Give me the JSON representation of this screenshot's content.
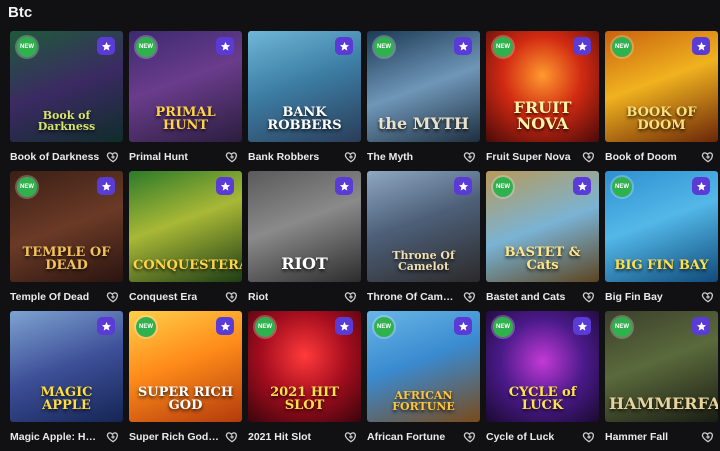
{
  "page": {
    "title": "Btc"
  },
  "colors": {
    "new_badge": "#2fb24e",
    "favorite_badge": "#5a3bd6",
    "background": "#111114"
  },
  "badges": {
    "new_label": "NEW"
  },
  "games": [
    {
      "name": "Book of Darkness",
      "art_title": "Book of Darkness",
      "new": true,
      "bg": "linear-gradient(160deg,#1f5a3a 0%,#3b2a63 50%,#0f2d2a 100%)",
      "title_color": "#d6e46a"
    },
    {
      "name": "Primal Hunt",
      "art_title": "PRIMAL HUNT",
      "new": true,
      "bg": "linear-gradient(160deg,#3c2a6e 0%,#6a3c8c 45%,#2a1e3d 100%)",
      "title_color": "#ffd24a"
    },
    {
      "name": "Bank Robbers",
      "art_title": "BANK ROBBERS",
      "new": false,
      "bg": "linear-gradient(160deg,#6fb7d8 0%,#3d7ea5 45%,#2a3d59 100%)",
      "title_color": "#ffffff"
    },
    {
      "name": "The Myth",
      "art_title": "the MYTH",
      "new": true,
      "bg": "linear-gradient(160deg,#1b3a55 0%,#6f96b8 50%,#1e2f3f 100%)",
      "title_color": "#e8e2cc"
    },
    {
      "name": "Fruit Super Nova",
      "art_title": "FRUIT NOVA",
      "new": true,
      "bg": "radial-gradient(circle at 50% 40%,#ff9a2e 0%,#d12a12 45%,#4a0a0a 100%)",
      "title_color": "#fff4a8"
    },
    {
      "name": "Book of Doom",
      "art_title": "BOOK OF DOOM",
      "new": true,
      "bg": "linear-gradient(160deg,#c9620f 0%,#f0b21f 45%,#6a2508 100%)",
      "title_color": "#ffe07a"
    },
    {
      "name": "Temple Of Dead",
      "art_title": "TEMPLE OF DEAD",
      "new": true,
      "bg": "linear-gradient(160deg,#3a1f16 0%,#6b3a26 50%,#2a1410 100%)",
      "title_color": "#f3c25a"
    },
    {
      "name": "Conquest Era",
      "art_title": "CONQUESTERA",
      "new": false,
      "bg": "linear-gradient(160deg,#2c7a2a 0%,#a9b836 45%,#1d3d16 100%)",
      "title_color": "#ffd34a"
    },
    {
      "name": "Riot",
      "art_title": "RIOT",
      "new": false,
      "bg": "linear-gradient(160deg,#5a5a5a 0%,#8a8a8a 45%,#2c2c2c 100%)",
      "title_color": "#ffffff"
    },
    {
      "name": "Throne Of Camelot",
      "art_title": "Throne Of Camelot",
      "new": false,
      "bg": "linear-gradient(160deg,#8fa8c3 0%,#4d5f78 45%,#2c2a2a 100%)",
      "title_color": "#f0e0b0"
    },
    {
      "name": "Bastet and Cats",
      "art_title": "BASTET & Cats",
      "new": true,
      "bg": "linear-gradient(160deg,#b79a5a 0%,#7ab3d4 50%,#5c4420 100%)",
      "title_color": "#ffe58a"
    },
    {
      "name": "Big Fin Bay",
      "art_title": "BIG FIN BAY",
      "new": true,
      "bg": "linear-gradient(160deg,#2f8fd0 0%,#53b8e8 45%,#0f4a7a 100%)",
      "title_color": "#ffe04a"
    },
    {
      "name": "Magic Apple: Hold ...",
      "art_title": "MAGIC APPLE",
      "new": false,
      "bg": "linear-gradient(160deg,#7ea3d1 0%,#3d4f98 50%,#152555 100%)",
      "title_color": "#ffdd3a"
    },
    {
      "name": "Super Rich God Ho...",
      "art_title": "SUPER RICH GOD",
      "new": true,
      "bg": "linear-gradient(160deg,#ffcf4a 0%,#ff8c1a 45%,#b23a0c 100%)",
      "title_color": "#ffffff"
    },
    {
      "name": "2021 Hit Slot",
      "art_title": "2021 HIT SLOT",
      "new": true,
      "bg": "radial-gradient(circle at 50% 40%,#ff3a3a 0%,#a30d1e 50%,#3a050c 100%)",
      "title_color": "#ffe04a"
    },
    {
      "name": "African Fortune",
      "art_title": "AFRICAN FORTUNE",
      "new": true,
      "bg": "linear-gradient(160deg,#68b7e6 0%,#3a8ad0 45%,#7a4a1a 100%)",
      "title_color": "#ffc43a"
    },
    {
      "name": "Cycle of Luck",
      "art_title": "CYCLE of LUCK",
      "new": true,
      "bg": "radial-gradient(circle at 50% 45%,#c23ad6 0%,#4a1a8a 50%,#1a0a30 100%)",
      "title_color": "#ffe34a"
    },
    {
      "name": "Hammer Fall",
      "art_title": "HAMMERFALL",
      "new": true,
      "bg": "linear-gradient(160deg,#3a3f2c 0%,#5b6a3c 45%,#1a1d14 100%)",
      "title_color": "#e8d49a"
    }
  ]
}
